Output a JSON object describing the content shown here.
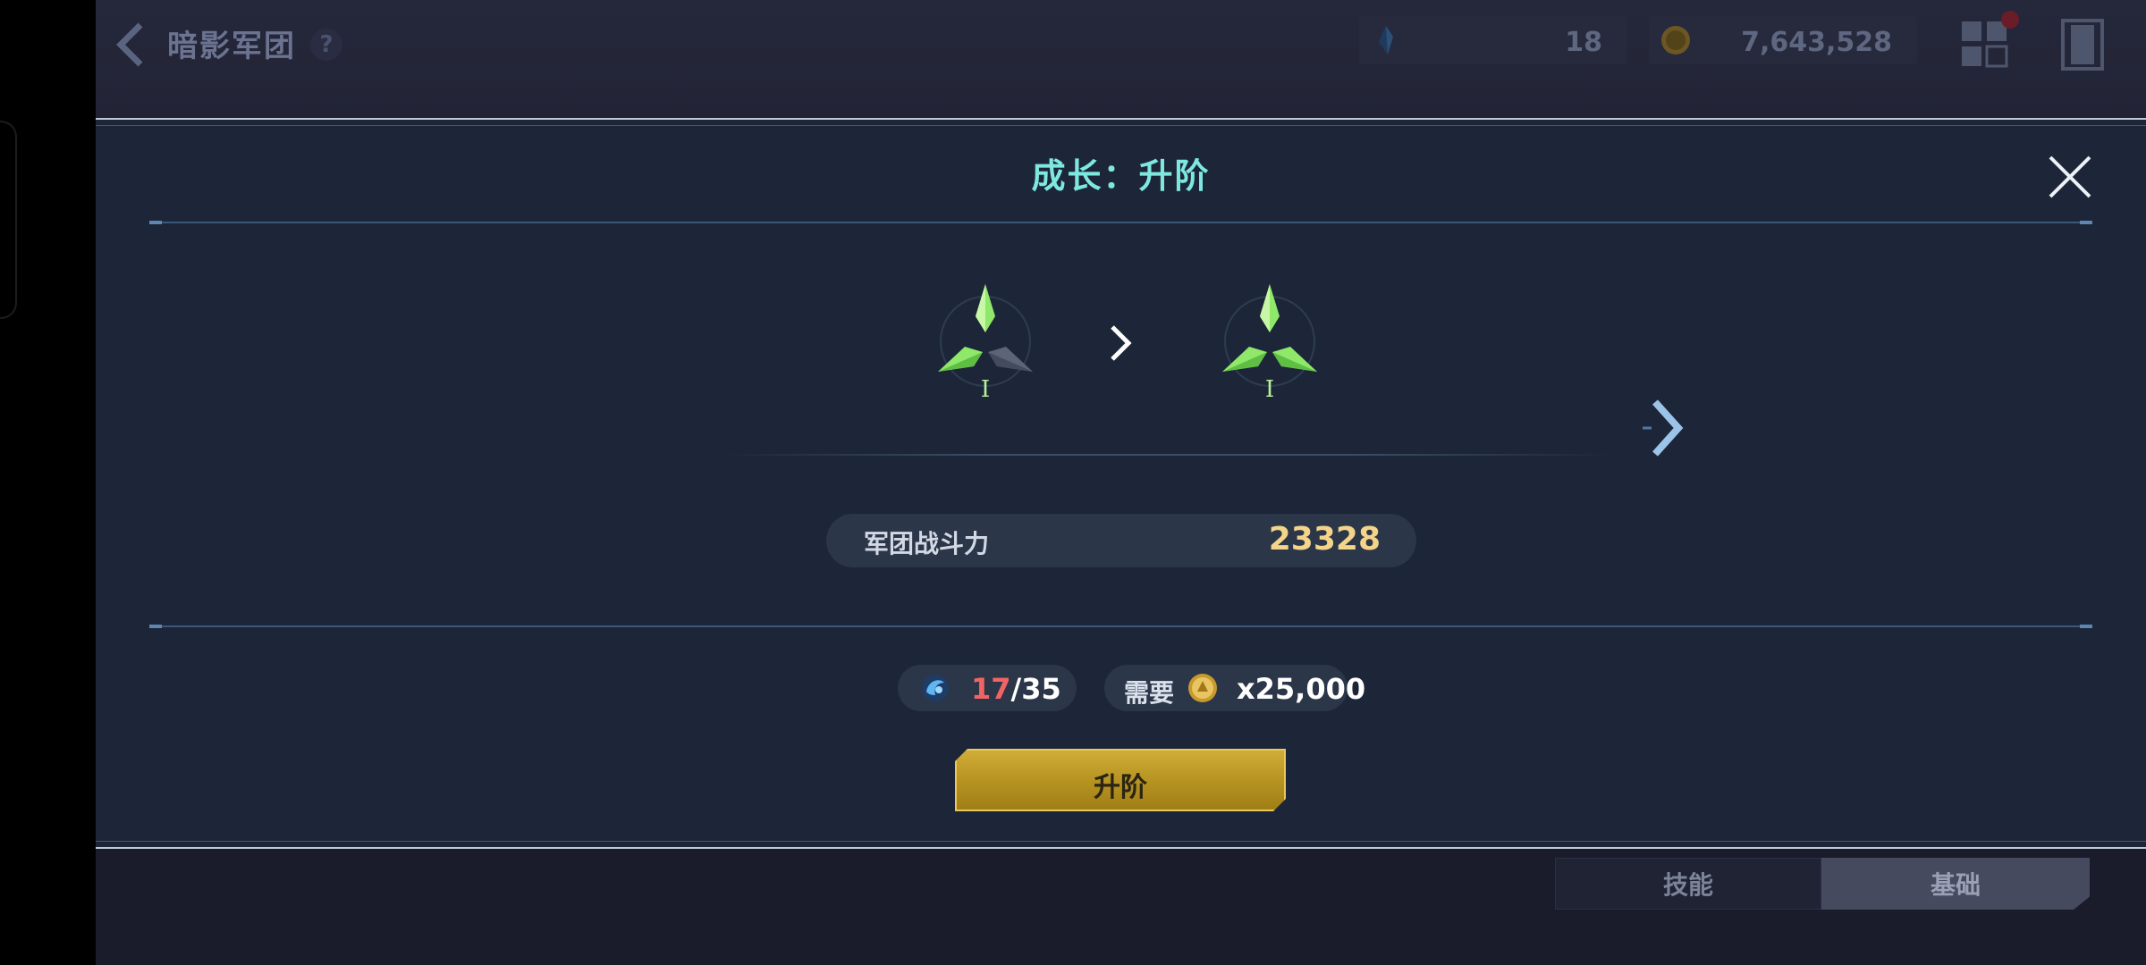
{
  "header": {
    "title": "暗影军团",
    "help": "?",
    "resources": {
      "crystal": "18",
      "gold": "7,643,528"
    },
    "notification_badge": "!"
  },
  "background_tabs": {
    "skill": "技能",
    "basic": "基础"
  },
  "modal": {
    "title": "成长：升阶",
    "rank_from": "I",
    "rank_to": "I",
    "power_label": "军团战斗力",
    "power_value": "23328",
    "stone_current": "17",
    "stone_separator": "/",
    "stone_required": "35",
    "cost_label": "需要",
    "cost_value": "x25,000",
    "upgrade_button": "升阶"
  },
  "colors": {
    "title_cyan": "#7ee8e0",
    "power_gold": "#f4d489",
    "insufficient_red": "#f26464",
    "button_gold": "#c9a52e",
    "gem_green": "#8fe86a"
  },
  "icons": [
    "back-arrow-icon",
    "help-icon",
    "crystal-icon",
    "gold-coin-icon",
    "grid-menu-icon",
    "exit-door-icon",
    "close-icon",
    "chevron-right-icon",
    "rank-emblem-icon",
    "soul-stone-icon"
  ]
}
